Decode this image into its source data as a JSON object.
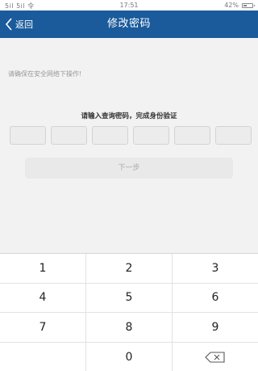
{
  "status_bar": {
    "signal": "5il 5il 令",
    "time": "17:51",
    "battery_text": "42%",
    "battery_level": 0.42
  },
  "nav": {
    "back_label": "返回",
    "title": "修改密码"
  },
  "notice": "请确保在安全网络下操作!",
  "prompt": "请输入查询密码，完成身份验证",
  "pin": {
    "length": 6
  },
  "next_button": "下一步",
  "keypad": {
    "rows": [
      [
        "1",
        "2",
        "3"
      ],
      [
        "4",
        "5",
        "6"
      ],
      [
        "7",
        "8",
        "9"
      ],
      [
        "",
        "0",
        "delete"
      ]
    ]
  },
  "colors": {
    "nav_bg": "#1b5b9b",
    "page_bg": "#f2f2f2"
  }
}
